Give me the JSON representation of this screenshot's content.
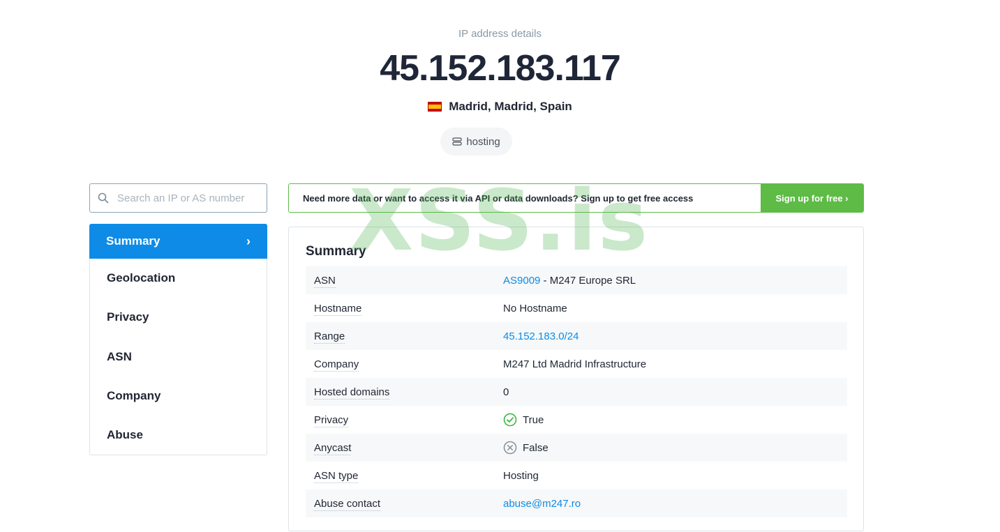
{
  "header": {
    "eyebrow": "IP address details",
    "ip": "45.152.183.117",
    "location": "Madrid, Madrid, Spain",
    "flag_icon": "spain-flag-icon",
    "tag_label": "hosting",
    "tag_icon": "server-icon"
  },
  "search": {
    "placeholder": "Search an IP or AS number",
    "icon": "search-icon"
  },
  "nav": {
    "items": [
      {
        "label": "Summary",
        "active": true
      },
      {
        "label": "Geolocation"
      },
      {
        "label": "Privacy"
      },
      {
        "label": "ASN"
      },
      {
        "label": "Company"
      },
      {
        "label": "Abuse"
      }
    ],
    "chevron": "›"
  },
  "banner": {
    "text": "Need more data or want to access it via API or data downloads? Sign up to get free access",
    "button": "Sign up for free ›"
  },
  "summary": {
    "title": "Summary",
    "rows": [
      {
        "key": "ASN",
        "link": "AS9009",
        "rest": " - M247 Europe SRL"
      },
      {
        "key": "Hostname",
        "value": "No Hostname"
      },
      {
        "key": "Range",
        "link": "45.152.183.0/24"
      },
      {
        "key": "Company",
        "value": "M247 Ltd Madrid Infrastructure"
      },
      {
        "key": "Hosted domains",
        "value": "0"
      },
      {
        "key": "Privacy",
        "value": "True",
        "icon": "check-circle-icon"
      },
      {
        "key": "Anycast",
        "value": "False",
        "icon": "x-circle-icon"
      },
      {
        "key": "ASN type",
        "value": "Hosting"
      },
      {
        "key": "Abuse contact",
        "link": "abuse@m247.ro"
      }
    ]
  },
  "colors": {
    "accent": "#0d8be6",
    "green": "#5dbb46"
  },
  "watermark": "XSS.is"
}
